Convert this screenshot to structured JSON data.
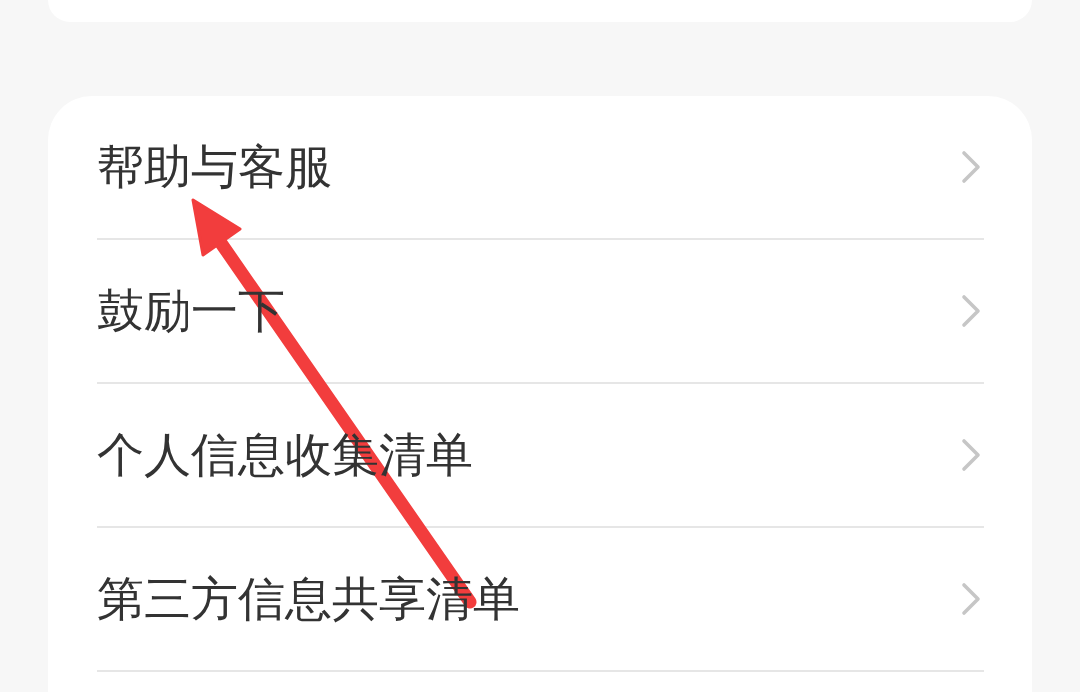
{
  "menu": {
    "items": [
      {
        "label": "帮助与客服"
      },
      {
        "label": "鼓励一下"
      },
      {
        "label": "个人信息收集清单"
      },
      {
        "label": "第三方信息共享清单"
      }
    ]
  }
}
